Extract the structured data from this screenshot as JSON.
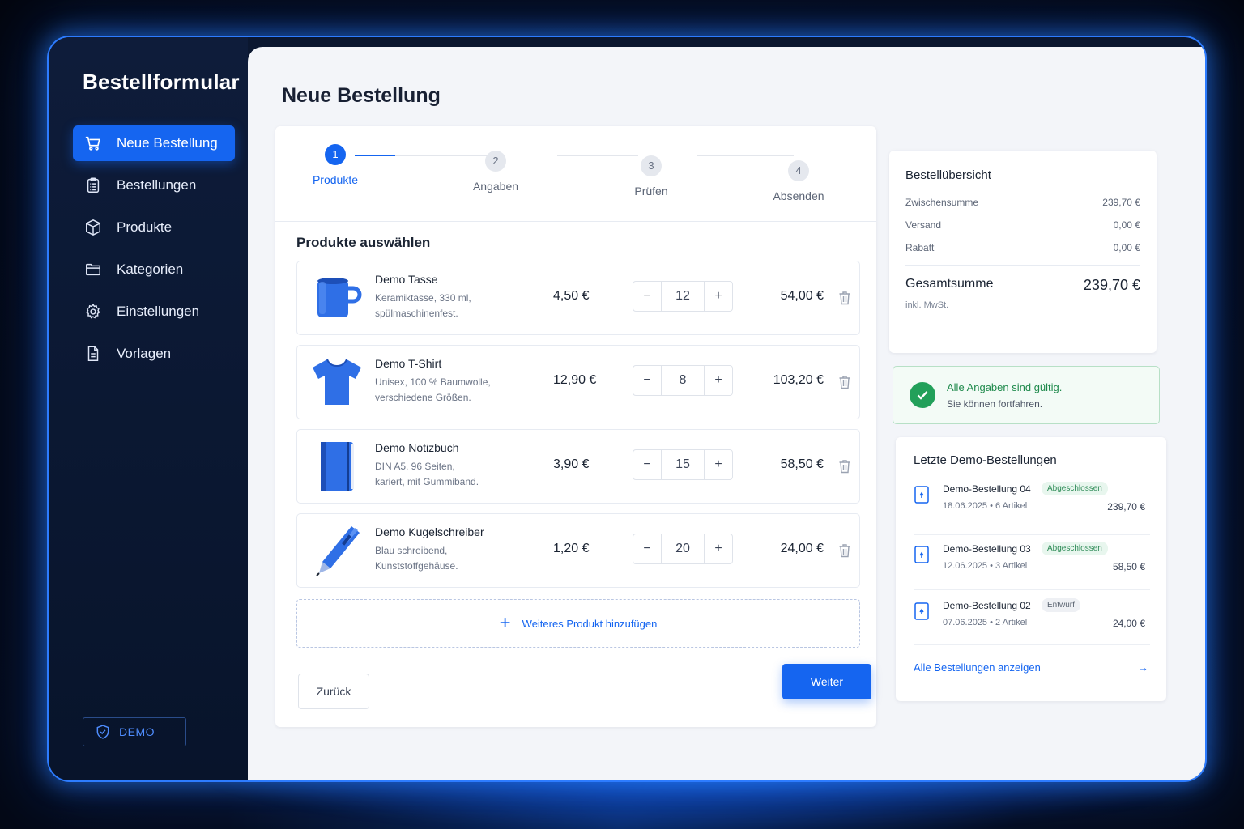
{
  "sidebar": {
    "brand": "Bestellformular",
    "items": [
      {
        "label": "Neue Bestellung",
        "icon": "cart-icon",
        "active": true
      },
      {
        "label": "Bestellungen",
        "icon": "clipboard-icon"
      },
      {
        "label": "Produkte",
        "icon": "box-icon"
      },
      {
        "label": "Kategorien",
        "icon": "folder-icon"
      },
      {
        "label": "Einstellungen",
        "icon": "gear-icon"
      },
      {
        "label": "Vorlagen",
        "icon": "document-icon"
      }
    ],
    "demo_label": "DEMO"
  },
  "page": {
    "title": "Neue Bestellung"
  },
  "stepper": {
    "steps": [
      {
        "number": "1",
        "label": "Produkte",
        "active": true
      },
      {
        "number": "2",
        "label": "Angaben"
      },
      {
        "number": "3",
        "label": "Prüfen"
      },
      {
        "number": "4",
        "label": "Absenden"
      }
    ]
  },
  "products": {
    "section_title": "Produkte auswählen",
    "items": [
      {
        "name": "Demo Tasse",
        "desc_line1": "Keramiktasse, 330 ml,",
        "desc_line2": "spülmaschinenfest.",
        "price": "4,50 €",
        "qty": "12",
        "total": "54,00 €",
        "image": "mug-icon"
      },
      {
        "name": "Demo T-Shirt",
        "desc_line1": "Unisex, 100 % Baumwolle,",
        "desc_line2": "verschiedene Größen.",
        "price": "12,90 €",
        "qty": "8",
        "total": "103,20 €",
        "image": "tshirt-icon"
      },
      {
        "name": "Demo Notizbuch",
        "desc_line1": "DIN A5, 96 Seiten,",
        "desc_line2": "kariert, mit Gummiband.",
        "price": "3,90 €",
        "qty": "15",
        "total": "58,50 €",
        "image": "notebook-icon"
      },
      {
        "name": "Demo Kugelschreiber",
        "desc_line1": "Blau schreibend,",
        "desc_line2": "Kunststoffgehäuse.",
        "price": "1,20 €",
        "qty": "20",
        "total": "24,00 €",
        "image": "pen-icon"
      }
    ],
    "minus": "−",
    "plus": "+",
    "add_label": "Weiteres Produkt hinzufügen",
    "add_plus": "+"
  },
  "buttons": {
    "back": "Zurück",
    "next": "Weiter"
  },
  "summary": {
    "title": "Bestellübersicht",
    "rows": [
      {
        "label": "Zwischensumme",
        "value": "239,70 €"
      },
      {
        "label": "Versand",
        "value": "0,00 €"
      },
      {
        "label": "Rabatt",
        "value": "0,00 €"
      }
    ],
    "total_label": "Gesamtsumme",
    "total_value": "239,70 €",
    "note": "inkl. MwSt."
  },
  "validation": {
    "title": "Alle Angaben sind gültig.",
    "subtitle": "Sie können fortfahren.",
    "color": "#22a05a"
  },
  "recent": {
    "title": "Letzte Demo-Bestellungen",
    "orders": [
      {
        "name": "Demo-Bestellung 04",
        "badge": "Abgeschlossen",
        "status": "done",
        "date": "18.06.2025",
        "items": "6 Artikel",
        "amount": "239,70 €"
      },
      {
        "name": "Demo-Bestellung 03",
        "badge": "Abgeschlossen",
        "status": "done",
        "date": "12.06.2025",
        "items": "3 Artikel",
        "amount": "58,50 €"
      },
      {
        "name": "Demo-Bestellung 02",
        "badge": "Entwurf",
        "status": "draft",
        "date": "07.06.2025",
        "items": "2 Artikel",
        "amount": "24,00 €"
      }
    ],
    "all_link": "Alle Bestellungen anzeigen",
    "arrow": "→",
    "separator": "•"
  },
  "colors": {
    "accent": "#1565f0",
    "sidebar_bg": "#0b1730",
    "success": "#22a05a"
  }
}
